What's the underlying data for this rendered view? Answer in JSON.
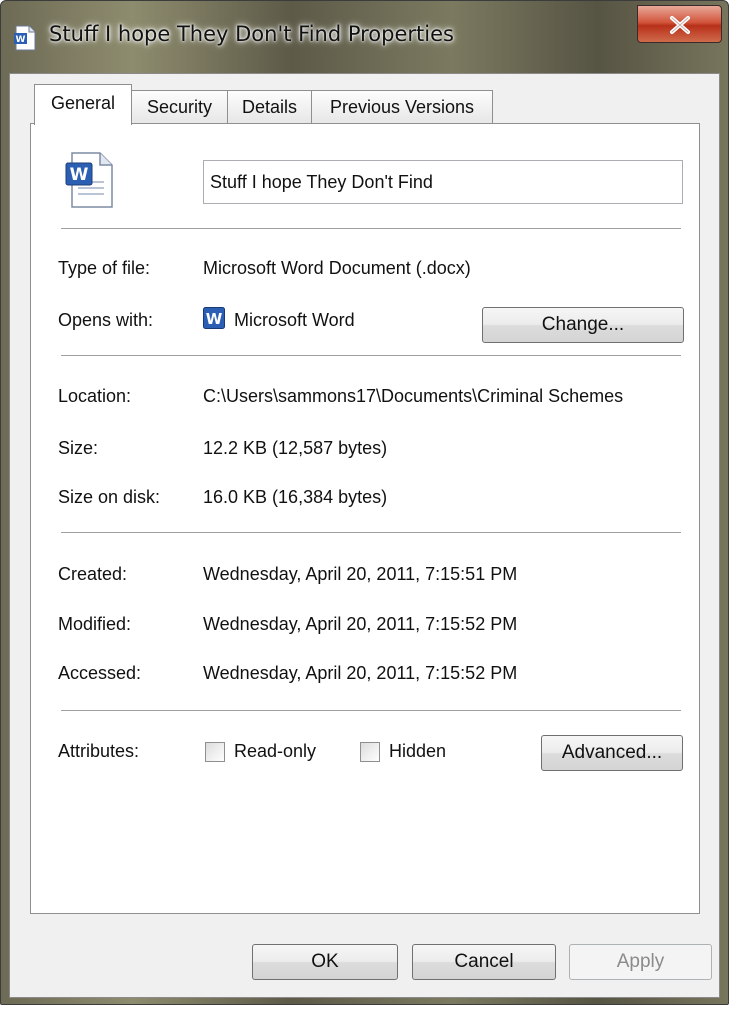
{
  "window": {
    "title": "Stuff I hope They Don't Find Properties"
  },
  "tabs": [
    {
      "label": "General"
    },
    {
      "label": "Security"
    },
    {
      "label": "Details"
    },
    {
      "label": "Previous Versions"
    }
  ],
  "general": {
    "file_name": "Stuff I hope They Don't Find",
    "type_label": "Type of file:",
    "type_value": "Microsoft Word Document (.docx)",
    "opens_label": "Opens with:",
    "opens_value": "Microsoft Word",
    "change_button": "Change...",
    "location_label": "Location:",
    "location_value": "C:\\Users\\sammons17\\Documents\\Criminal Schemes",
    "size_label": "Size:",
    "size_value": "12.2 KB (12,587 bytes)",
    "size_disk_label": "Size on disk:",
    "size_disk_value": "16.0 KB (16,384 bytes)",
    "created_label": "Created:",
    "created_value": "Wednesday, April 20, 2011, 7:15:51 PM",
    "modified_label": "Modified:",
    "modified_value": "Wednesday, April 20, 2011, 7:15:52 PM",
    "accessed_label": "Accessed:",
    "accessed_value": "Wednesday, April 20, 2011, 7:15:52 PM",
    "attributes_label": "Attributes:",
    "readonly_label": "Read-only",
    "hidden_label": "Hidden",
    "advanced_button": "Advanced..."
  },
  "footer": {
    "ok": "OK",
    "cancel": "Cancel",
    "apply": "Apply"
  },
  "icons": {
    "title": "word-document-icon",
    "file": "word-document-icon",
    "app": "microsoft-word-icon",
    "close": "close-icon"
  },
  "colors": {
    "word_blue": "#2b5fb3",
    "close_red": "#c9422a"
  }
}
